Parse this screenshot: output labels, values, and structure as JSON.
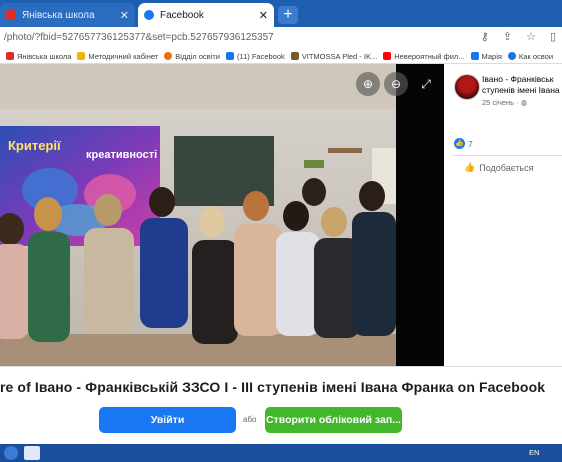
{
  "browser": {
    "tabs": [
      {
        "title": "Янівська школа",
        "active": false,
        "favicon_color": "#d93025"
      },
      {
        "title": "Facebook",
        "active": true,
        "favicon_color": "#1877f2"
      }
    ],
    "url": "/photo/?fbid=527657736125377&set=pcb.527657936125357",
    "bookmarks": [
      {
        "label": "Янівська школа",
        "color": "#d93025"
      },
      {
        "label": "Методичний кабінет",
        "color": "#f2b400"
      },
      {
        "label": "Відділ освіти",
        "color": "#e8710a"
      },
      {
        "label": "(11) Facebook",
        "color": "#1877f2"
      },
      {
        "label": "VITMOSSA Pled - IK...",
        "color": "#7a5b2e"
      },
      {
        "label": "Невероятный фил...",
        "color": "#ff0000"
      },
      {
        "label": "Марія",
        "color": "#1877f2"
      },
      {
        "label": "Как освои",
        "color": "#1a73e8"
      }
    ]
  },
  "photo": {
    "board_text_1": "Критерії",
    "board_text_2": "креативності",
    "zoom_in_icon": "zoom-in-icon",
    "zoom_out_icon": "zoom-out-icon",
    "expand_icon": "expand-icon"
  },
  "post": {
    "author": "Івано - Франківськ ступенів імені Івана",
    "date": "25 січень · ",
    "like_count": "7",
    "like_button": "Подобається"
  },
  "banner": {
    "text": "re of Івано - Франківській ЗЗСО І - ІІІ ступенів імені Івана Франка on Facebook",
    "login_label": "Увійти",
    "or_label": "або",
    "create_label": "Створити обліковий зап..."
  },
  "taskbar": {
    "lang": "EN"
  }
}
